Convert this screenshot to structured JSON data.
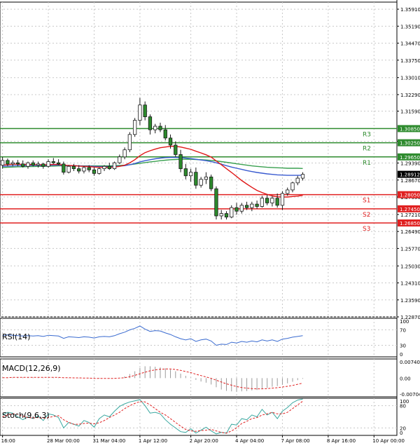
{
  "chart_data": {
    "type": "candlestick",
    "main": {
      "y_ticks": [
        1.3591,
        1.3519,
        1.3447,
        1.3375,
        1.3301,
        1.3229,
        1.3159,
        1.3031,
        1.2939,
        1.2867,
        1.2795,
        1.2721,
        1.2649,
        1.2577,
        1.2503,
        1.2431,
        1.2359,
        1.2287
      ],
      "y_tick_labels": [
        "1.35910",
        "1.35190",
        "1.34470",
        "1.33750",
        "1.33010",
        "1.32290",
        "1.31590",
        "1.30310",
        "1.29390",
        "1.28670",
        "1.27950",
        "1.27210",
        "1.26490",
        "1.25770",
        "1.25030",
        "1.24310",
        "1.23590",
        "1.22870"
      ],
      "ylim": [
        1.2287,
        1.3621
      ],
      "current_price": 1.28912,
      "current_price_label": "1.28912",
      "levels": [
        {
          "name": "R3",
          "value": 1.3085,
          "label": "1.30850",
          "color": "#2e8b2e"
        },
        {
          "name": "R2",
          "value": 1.3025,
          "label": "1.30250",
          "color": "#2e8b2e"
        },
        {
          "name": "R1",
          "value": 1.2965,
          "label": "1.29650",
          "color": "#2e8b2e"
        },
        {
          "name": "S1",
          "value": 1.2805,
          "label": "1.28050",
          "color": "#e02020"
        },
        {
          "name": "S2",
          "value": 1.2745,
          "label": "1.27450",
          "color": "#e02020"
        },
        {
          "name": "S3",
          "value": 1.2685,
          "label": "1.26850",
          "color": "#e02020"
        }
      ],
      "candles": [
        {
          "o": 1.293,
          "h": 1.2965,
          "l": 1.2915,
          "c": 1.295
        },
        {
          "o": 1.295,
          "h": 1.2958,
          "l": 1.2925,
          "c": 1.2935
        },
        {
          "o": 1.2935,
          "h": 1.295,
          "l": 1.2925,
          "c": 1.294
        },
        {
          "o": 1.294,
          "h": 1.2952,
          "l": 1.2925,
          "c": 1.2935
        },
        {
          "o": 1.2935,
          "h": 1.295,
          "l": 1.292,
          "c": 1.2925
        },
        {
          "o": 1.2925,
          "h": 1.2945,
          "l": 1.2915,
          "c": 1.294
        },
        {
          "o": 1.294,
          "h": 1.295,
          "l": 1.2925,
          "c": 1.293
        },
        {
          "o": 1.293,
          "h": 1.2945,
          "l": 1.292,
          "c": 1.2935
        },
        {
          "o": 1.2935,
          "h": 1.294,
          "l": 1.2915,
          "c": 1.2925
        },
        {
          "o": 1.2925,
          "h": 1.2955,
          "l": 1.292,
          "c": 1.2945
        },
        {
          "o": 1.2945,
          "h": 1.296,
          "l": 1.2935,
          "c": 1.294
        },
        {
          "o": 1.294,
          "h": 1.2955,
          "l": 1.293,
          "c": 1.2935
        },
        {
          "o": 1.2935,
          "h": 1.2945,
          "l": 1.289,
          "c": 1.29
        },
        {
          "o": 1.29,
          "h": 1.293,
          "l": 1.2895,
          "c": 1.2925
        },
        {
          "o": 1.2925,
          "h": 1.2935,
          "l": 1.2905,
          "c": 1.2915
        },
        {
          "o": 1.2915,
          "h": 1.293,
          "l": 1.2895,
          "c": 1.2905
        },
        {
          "o": 1.2905,
          "h": 1.2925,
          "l": 1.2895,
          "c": 1.292
        },
        {
          "o": 1.292,
          "h": 1.293,
          "l": 1.29,
          "c": 1.291
        },
        {
          "o": 1.291,
          "h": 1.292,
          "l": 1.2885,
          "c": 1.2895
        },
        {
          "o": 1.2895,
          "h": 1.292,
          "l": 1.289,
          "c": 1.2915
        },
        {
          "o": 1.2915,
          "h": 1.293,
          "l": 1.2905,
          "c": 1.2925
        },
        {
          "o": 1.2925,
          "h": 1.294,
          "l": 1.291,
          "c": 1.2915
        },
        {
          "o": 1.2915,
          "h": 1.2945,
          "l": 1.291,
          "c": 1.294
        },
        {
          "o": 1.294,
          "h": 1.2975,
          "l": 1.2935,
          "c": 1.2965
        },
        {
          "o": 1.2965,
          "h": 1.3005,
          "l": 1.2955,
          "c": 1.2995
        },
        {
          "o": 1.2995,
          "h": 1.307,
          "l": 1.2985,
          "c": 1.306
        },
        {
          "o": 1.306,
          "h": 1.313,
          "l": 1.305,
          "c": 1.312
        },
        {
          "o": 1.312,
          "h": 1.3215,
          "l": 1.31,
          "c": 1.3185
        },
        {
          "o": 1.3185,
          "h": 1.32,
          "l": 1.312,
          "c": 1.3135
        },
        {
          "o": 1.3135,
          "h": 1.3145,
          "l": 1.306,
          "c": 1.308
        },
        {
          "o": 1.308,
          "h": 1.3105,
          "l": 1.3065,
          "c": 1.3095
        },
        {
          "o": 1.3095,
          "h": 1.311,
          "l": 1.307,
          "c": 1.308
        },
        {
          "o": 1.308,
          "h": 1.31,
          "l": 1.3035,
          "c": 1.3045
        },
        {
          "o": 1.3045,
          "h": 1.306,
          "l": 1.3,
          "c": 1.3015
        },
        {
          "o": 1.3015,
          "h": 1.303,
          "l": 1.2965,
          "c": 1.2975
        },
        {
          "o": 1.2975,
          "h": 1.2995,
          "l": 1.29,
          "c": 1.2915
        },
        {
          "o": 1.2915,
          "h": 1.2935,
          "l": 1.287,
          "c": 1.2885
        },
        {
          "o": 1.2885,
          "h": 1.2915,
          "l": 1.286,
          "c": 1.29
        },
        {
          "o": 1.29,
          "h": 1.292,
          "l": 1.283,
          "c": 1.2845
        },
        {
          "o": 1.2845,
          "h": 1.288,
          "l": 1.2835,
          "c": 1.287
        },
        {
          "o": 1.287,
          "h": 1.29,
          "l": 1.285,
          "c": 1.288
        },
        {
          "o": 1.288,
          "h": 1.289,
          "l": 1.282,
          "c": 1.283
        },
        {
          "o": 1.283,
          "h": 1.284,
          "l": 1.27,
          "c": 1.2715
        },
        {
          "o": 1.2715,
          "h": 1.274,
          "l": 1.27,
          "c": 1.2725
        },
        {
          "o": 1.2725,
          "h": 1.2735,
          "l": 1.27,
          "c": 1.271
        },
        {
          "o": 1.271,
          "h": 1.276,
          "l": 1.2705,
          "c": 1.275
        },
        {
          "o": 1.275,
          "h": 1.277,
          "l": 1.272,
          "c": 1.2735
        },
        {
          "o": 1.2735,
          "h": 1.277,
          "l": 1.2725,
          "c": 1.276
        },
        {
          "o": 1.276,
          "h": 1.2775,
          "l": 1.274,
          "c": 1.275
        },
        {
          "o": 1.275,
          "h": 1.2775,
          "l": 1.2735,
          "c": 1.2765
        },
        {
          "o": 1.2765,
          "h": 1.278,
          "l": 1.2745,
          "c": 1.2755
        },
        {
          "o": 1.2755,
          "h": 1.28,
          "l": 1.275,
          "c": 1.279
        },
        {
          "o": 1.279,
          "h": 1.2805,
          "l": 1.276,
          "c": 1.277
        },
        {
          "o": 1.277,
          "h": 1.28,
          "l": 1.2755,
          "c": 1.279
        },
        {
          "o": 1.279,
          "h": 1.281,
          "l": 1.275,
          "c": 1.276
        },
        {
          "o": 1.276,
          "h": 1.282,
          "l": 1.274,
          "c": 1.281
        },
        {
          "o": 1.281,
          "h": 1.2835,
          "l": 1.28,
          "c": 1.2825
        },
        {
          "o": 1.2825,
          "h": 1.286,
          "l": 1.2815,
          "c": 1.2855
        },
        {
          "o": 1.2855,
          "h": 1.2885,
          "l": 1.2845,
          "c": 1.2875
        },
        {
          "o": 1.2875,
          "h": 1.29,
          "l": 1.2865,
          "c": 1.2891
        }
      ],
      "ma_fast": [
        1.293,
        1.2932,
        1.2934,
        1.2934,
        1.2933,
        1.2933,
        1.2932,
        1.2932,
        1.2931,
        1.2932,
        1.2933,
        1.2933,
        1.293,
        1.2929,
        1.2928,
        1.2926,
        1.2925,
        1.2924,
        1.2922,
        1.2921,
        1.2921,
        1.2921,
        1.2922,
        1.2925,
        1.293,
        1.294,
        1.2953,
        1.297,
        1.2983,
        1.2991,
        1.2998,
        1.3004,
        1.3007,
        1.301,
        1.301,
        1.3007,
        1.3002,
        1.2997,
        1.2989,
        1.2982,
        1.2974,
        1.2964,
        1.2948,
        1.2932,
        1.2915,
        1.2899,
        1.2882,
        1.2865,
        1.285,
        1.2836,
        1.2823,
        1.2814,
        1.2806,
        1.28,
        1.2796,
        1.2795,
        1.2795,
        1.2797,
        1.2799,
        1.2802
      ],
      "ma_mid": [
        1.2925,
        1.2926,
        1.2927,
        1.2928,
        1.2928,
        1.2929,
        1.2929,
        1.2929,
        1.2929,
        1.2929,
        1.293,
        1.293,
        1.2929,
        1.2928,
        1.2928,
        1.2927,
        1.2926,
        1.2926,
        1.2925,
        1.2924,
        1.2924,
        1.2924,
        1.2925,
        1.2926,
        1.2928,
        1.2932,
        1.2937,
        1.2944,
        1.2949,
        1.2953,
        1.2957,
        1.296,
        1.2962,
        1.2963,
        1.2963,
        1.2962,
        1.296,
        1.2958,
        1.2955,
        1.2952,
        1.2949,
        1.2945,
        1.294,
        1.2934,
        1.2928,
        1.2922,
        1.2917,
        1.2912,
        1.2907,
        1.2903,
        1.2899,
        1.2896,
        1.2893,
        1.2891,
        1.2889,
        1.2888,
        1.2887,
        1.2887,
        1.2887,
        1.2887
      ],
      "ma_slow": [
        1.292,
        1.2921,
        1.2922,
        1.2923,
        1.2923,
        1.2924,
        1.2924,
        1.2925,
        1.2925,
        1.2926,
        1.2926,
        1.2927,
        1.2927,
        1.2927,
        1.2927,
        1.2927,
        1.2927,
        1.2927,
        1.2927,
        1.2927,
        1.2927,
        1.2927,
        1.2928,
        1.2929,
        1.293,
        1.2932,
        1.2935,
        1.2938,
        1.2941,
        1.2944,
        1.2946,
        1.2949,
        1.2951,
        1.2953,
        1.2954,
        1.2955,
        1.2955,
        1.2955,
        1.2954,
        1.2953,
        1.2952,
        1.295,
        1.2948,
        1.2945,
        1.2942,
        1.2939,
        1.2936,
        1.2933,
        1.293,
        1.2927,
        1.2925,
        1.2923,
        1.2921,
        1.292,
        1.2919,
        1.2918,
        1.2917,
        1.2917,
        1.2917,
        1.2916
      ],
      "ma_colors": {
        "fast": "#e01818",
        "mid": "#3a5bd0",
        "slow": "#3aa050"
      },
      "candle_colors": {
        "up": "#ffffff",
        "down": "#2c8a2c",
        "border": "#1a1a1a"
      }
    },
    "rsi": {
      "label": "RSI(14)",
      "y_ticks": [
        100,
        70,
        30,
        0
      ],
      "y_tick_labels": [
        "100",
        "70",
        "30",
        "0"
      ],
      "ylim": [
        0,
        100
      ],
      "values": [
        55,
        57,
        56,
        55,
        54,
        55,
        54,
        55,
        53,
        56,
        55,
        54,
        48,
        52,
        51,
        50,
        52,
        51,
        49,
        52,
        53,
        52,
        55,
        60,
        64,
        70,
        74,
        80,
        72,
        66,
        68,
        67,
        62,
        58,
        52,
        47,
        44,
        47,
        40,
        44,
        46,
        41,
        30,
        33,
        32,
        38,
        36,
        40,
        38,
        41,
        39,
        44,
        41,
        44,
        40,
        46,
        48,
        51,
        53,
        55
      ],
      "color": "#3a6bd0"
    },
    "macd": {
      "label": "MACD(12,26,9)",
      "y_ticks": [
        0.007403,
        0.0,
        -0.007045
      ],
      "y_tick_labels": [
        "0.007403",
        "0.00",
        "-0.007045"
      ],
      "ylim": [
        -0.0082,
        0.0084
      ],
      "histogram": [
        0.0002,
        0.0003,
        0.0003,
        0.0003,
        0.0003,
        0.0003,
        0.0003,
        0.0003,
        0.0002,
        0.0003,
        0.0003,
        0.0003,
        0.0001,
        0.0001,
        0.0,
        -0.0001,
        -0.0001,
        -0.0001,
        -0.0002,
        -0.0002,
        -0.0002,
        -0.0002,
        -0.0001,
        0.0002,
        0.0008,
        0.0018,
        0.003,
        0.0045,
        0.0052,
        0.0052,
        0.005,
        0.0047,
        0.0043,
        0.0037,
        0.003,
        0.002,
        0.001,
        0.0002,
        -0.0008,
        -0.0015,
        -0.002,
        -0.0028,
        -0.004,
        -0.005,
        -0.0056,
        -0.0058,
        -0.006,
        -0.0058,
        -0.0057,
        -0.0054,
        -0.0052,
        -0.0047,
        -0.0043,
        -0.0038,
        -0.0035,
        -0.0029,
        -0.0023,
        -0.0016,
        -0.0009,
        -0.0003
      ],
      "signal": [
        0.0002,
        0.0002,
        0.0003,
        0.0003,
        0.0003,
        0.0003,
        0.0003,
        0.0003,
        0.0003,
        0.0003,
        0.0003,
        0.0003,
        0.0002,
        0.0002,
        0.0001,
        0.0001,
        0.0,
        0.0,
        -0.0001,
        -0.0001,
        -0.0001,
        -0.0001,
        -0.0001,
        0.0,
        0.0002,
        0.0006,
        0.0012,
        0.0019,
        0.0026,
        0.0032,
        0.0036,
        0.0039,
        0.004,
        0.004,
        0.0038,
        0.0034,
        0.0029,
        0.0024,
        0.0017,
        0.0011,
        0.0005,
        -0.0001,
        -0.0009,
        -0.0017,
        -0.0025,
        -0.0031,
        -0.0037,
        -0.0041,
        -0.0044,
        -0.0046,
        -0.0047,
        -0.0047,
        -0.0046,
        -0.0044,
        -0.0042,
        -0.0039,
        -0.0036,
        -0.0032,
        -0.0027,
        -0.0022
      ],
      "hist_color": "#9a9a9a",
      "signal_color": "#e02020"
    },
    "stoch": {
      "label": "Stoch(9,6,3)",
      "y_ticks": [
        100,
        80,
        20,
        0
      ],
      "y_tick_labels": [
        "100",
        "80",
        "20",
        "0"
      ],
      "ylim": [
        0,
        100
      ],
      "main": [
        55,
        62,
        60,
        50,
        42,
        50,
        45,
        52,
        40,
        58,
        55,
        48,
        20,
        35,
        30,
        25,
        40,
        35,
        22,
        45,
        55,
        50,
        65,
        78,
        85,
        90,
        93,
        96,
        80,
        60,
        62,
        58,
        42,
        30,
        20,
        10,
        8,
        18,
        6,
        14,
        22,
        12,
        4,
        8,
        6,
        30,
        28,
        45,
        42,
        55,
        50,
        70,
        55,
        62,
        45,
        65,
        75,
        88,
        95,
        98
      ],
      "signal": [
        50,
        55,
        58,
        57,
        52,
        48,
        47,
        48,
        46,
        48,
        51,
        53,
        42,
        35,
        30,
        30,
        32,
        33,
        31,
        34,
        40,
        48,
        55,
        62,
        72,
        80,
        86,
        91,
        90,
        82,
        72,
        62,
        55,
        45,
        35,
        25,
        16,
        12,
        11,
        13,
        14,
        16,
        12,
        8,
        6,
        12,
        20,
        32,
        38,
        45,
        48,
        55,
        58,
        62,
        58,
        58,
        62,
        72,
        82,
        92
      ],
      "main_color": "#3aa8a0",
      "signal_color": "#e02020"
    },
    "x_tick_labels": [
      "16:00",
      "28 Mar 00:00",
      "31 Mar 04:00",
      "1 Apr 12:00",
      "2 Apr 20:00",
      "4 Apr 04:00",
      "7 Apr 08:00",
      "8 Apr 16:00",
      "10 Apr 00:00"
    ],
    "x_tick_index": [
      0,
      9,
      18,
      27,
      37,
      46,
      55,
      64,
      73
    ]
  }
}
